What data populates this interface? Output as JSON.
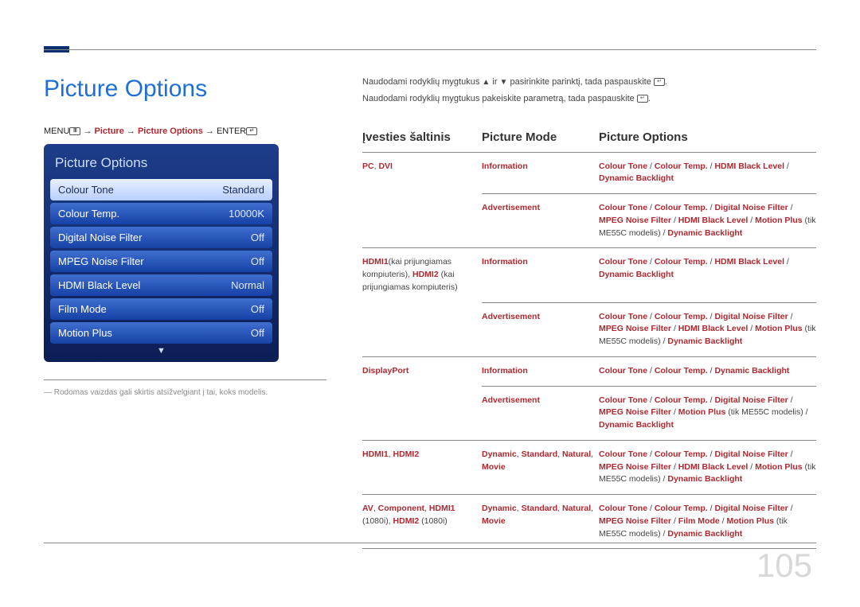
{
  "title": "Picture Options",
  "breadcrumb": {
    "menu": "MENU",
    "arrow": " → ",
    "picture": "Picture",
    "picture_options": "Picture Options",
    "enter": "ENTER"
  },
  "panel": {
    "title": "Picture Options",
    "rows": [
      {
        "label": "Colour Tone",
        "value": "Standard",
        "highlight": true
      },
      {
        "label": "Colour Temp.",
        "value": "10000K"
      },
      {
        "label": "Digital Noise Filter",
        "value": "Off"
      },
      {
        "label": "MPEG Noise Filter",
        "value": "Off"
      },
      {
        "label": "HDMI Black Level",
        "value": "Normal"
      },
      {
        "label": "Film Mode",
        "value": "Off"
      },
      {
        "label": "Motion Plus",
        "value": "Off"
      }
    ]
  },
  "note": "― Rodomas vaizdas gali skirtis atsižvelgiant į tai, koks modelis.",
  "instructions": {
    "line1_a": "Naudodami rodyklių mygtukus ",
    "line1_b": " ir ",
    "line1_c": " pasirinkite parinktį, tada paspauskite ",
    "line1_d": ".",
    "line2_a": "Naudodami rodyklių mygtukus pakeiskite parametrą, tada paspauskite ",
    "line2_b": "."
  },
  "headers": {
    "c1": "Įvesties šaltinis",
    "c2": "Picture Mode",
    "c3": "Picture Options"
  },
  "rows": [
    {
      "source_red": "PC",
      "source_black": ", ",
      "source_red2": "DVI",
      "sub": [
        {
          "mode": [
            [
              "Information",
              "red"
            ]
          ],
          "opts": [
            [
              "Colour Tone",
              "red"
            ],
            [
              " / ",
              "black"
            ],
            [
              "Colour Temp.",
              "red"
            ],
            [
              " / ",
              "black"
            ],
            [
              "HDMI Black Level",
              "red"
            ],
            [
              " / ",
              "black"
            ],
            [
              "Dynamic Backlight",
              "red"
            ]
          ]
        },
        {
          "mode": [
            [
              "Advertisement",
              "red"
            ]
          ],
          "opts": [
            [
              "Colour Tone",
              "red"
            ],
            [
              " / ",
              "black"
            ],
            [
              "Colour Temp.",
              "red"
            ],
            [
              " / ",
              "black"
            ],
            [
              "Digital Noise Filter",
              "red"
            ],
            [
              " / ",
              "black"
            ],
            [
              "MPEG Noise Filter",
              "red"
            ],
            [
              " / ",
              "black"
            ],
            [
              "HDMI Black Level",
              "red"
            ],
            [
              " / ",
              "black"
            ],
            [
              "Motion Plus",
              "red"
            ],
            [
              " (tik ME55C modelis) / ",
              "black"
            ],
            [
              "Dynamic Backlight",
              "red"
            ]
          ]
        }
      ]
    },
    {
      "source_lines": [
        [
          "HDMI1",
          "red"
        ],
        [
          "(kai prijungiamas kompiuteris), ",
          "black"
        ],
        [
          "HDMI2",
          "red"
        ],
        [
          " (kai prijungiamas kompiuteris)",
          "black"
        ]
      ],
      "sub": [
        {
          "mode": [
            [
              "Information",
              "red"
            ]
          ],
          "opts": [
            [
              "Colour Tone",
              "red"
            ],
            [
              " / ",
              "black"
            ],
            [
              "Colour Temp.",
              "red"
            ],
            [
              " / ",
              "black"
            ],
            [
              "HDMI Black Level",
              "red"
            ],
            [
              " / ",
              "black"
            ],
            [
              "Dynamic Backlight",
              "red"
            ]
          ]
        },
        {
          "mode": [
            [
              "Advertisement",
              "red"
            ]
          ],
          "opts": [
            [
              "Colour Tone",
              "red"
            ],
            [
              " / ",
              "black"
            ],
            [
              "Colour Temp.",
              "red"
            ],
            [
              " / ",
              "black"
            ],
            [
              "Digital Noise Filter",
              "red"
            ],
            [
              " / ",
              "black"
            ],
            [
              "MPEG Noise Filter",
              "red"
            ],
            [
              " / ",
              "black"
            ],
            [
              "HDMI Black Level",
              "red"
            ],
            [
              " / ",
              "black"
            ],
            [
              "Motion Plus",
              "red"
            ],
            [
              " (tik ME55C modelis) / ",
              "black"
            ],
            [
              "Dynamic Backlight",
              "red"
            ]
          ]
        }
      ]
    },
    {
      "source_lines": [
        [
          "DisplayPort",
          "red"
        ]
      ],
      "sub": [
        {
          "mode": [
            [
              "Information",
              "red"
            ]
          ],
          "opts": [
            [
              "Colour Tone",
              "red"
            ],
            [
              " / ",
              "black"
            ],
            [
              "Colour Temp.",
              "red"
            ],
            [
              " / ",
              "black"
            ],
            [
              "Dynamic Backlight",
              "red"
            ]
          ]
        },
        {
          "mode": [
            [
              "Advertisement",
              "red"
            ]
          ],
          "opts": [
            [
              "Colour Tone",
              "red"
            ],
            [
              " / ",
              "black"
            ],
            [
              "Colour Temp.",
              "red"
            ],
            [
              " / ",
              "black"
            ],
            [
              "Digital Noise Filter",
              "red"
            ],
            [
              " / ",
              "black"
            ],
            [
              "MPEG Noise Filter",
              "red"
            ],
            [
              " / ",
              "black"
            ],
            [
              "Motion Plus",
              "red"
            ],
            [
              " (tik ME55C modelis) / ",
              "black"
            ],
            [
              "Dynamic Backlight",
              "red"
            ]
          ]
        }
      ]
    },
    {
      "source_lines": [
        [
          "HDMI1",
          "red"
        ],
        [
          ", ",
          "black"
        ],
        [
          "HDMI2",
          "red"
        ]
      ],
      "sub": [
        {
          "mode": [
            [
              "Dynamic",
              "red"
            ],
            [
              ", ",
              "black"
            ],
            [
              "Standard",
              "red"
            ],
            [
              ", ",
              "black"
            ],
            [
              "Natural",
              "red"
            ],
            [
              ", ",
              "black"
            ],
            [
              "Movie",
              "red"
            ]
          ],
          "opts": [
            [
              "Colour Tone",
              "red"
            ],
            [
              " / ",
              "black"
            ],
            [
              "Colour Temp.",
              "red"
            ],
            [
              " / ",
              "black"
            ],
            [
              "Digital Noise Filter",
              "red"
            ],
            [
              " / ",
              "black"
            ],
            [
              "MPEG Noise Filter",
              "red"
            ],
            [
              " / ",
              "black"
            ],
            [
              "HDMI Black Level",
              "red"
            ],
            [
              " / ",
              "black"
            ],
            [
              "Motion Plus",
              "red"
            ],
            [
              " (tik ME55C modelis) / ",
              "black"
            ],
            [
              "Dynamic Backlight",
              "red"
            ]
          ]
        }
      ]
    },
    {
      "source_lines": [
        [
          "AV",
          "red"
        ],
        [
          ", ",
          "black"
        ],
        [
          "Component",
          "red"
        ],
        [
          ", ",
          "black"
        ],
        [
          "HDMI1",
          "red"
        ],
        [
          " (1080i), ",
          "black"
        ],
        [
          "HDMI2",
          "red"
        ],
        [
          " (1080i)",
          "black"
        ]
      ],
      "sub": [
        {
          "mode": [
            [
              "Dynamic",
              "red"
            ],
            [
              ", ",
              "black"
            ],
            [
              "Standard",
              "red"
            ],
            [
              ", ",
              "black"
            ],
            [
              "Natural",
              "red"
            ],
            [
              ", ",
              "black"
            ],
            [
              "Movie",
              "red"
            ]
          ],
          "opts": [
            [
              "Colour Tone",
              "red"
            ],
            [
              " / ",
              "black"
            ],
            [
              "Colour Temp.",
              "red"
            ],
            [
              " / ",
              "black"
            ],
            [
              "Digital Noise Filter",
              "red"
            ],
            [
              " / ",
              "black"
            ],
            [
              "MPEG Noise Filter",
              "red"
            ],
            [
              " / ",
              "black"
            ],
            [
              "Film Mode",
              "red"
            ],
            [
              " / ",
              "black"
            ],
            [
              "Motion Plus",
              "red"
            ],
            [
              " (tik ME55C modelis) / ",
              "black"
            ],
            [
              "Dynamic Backlight",
              "red"
            ]
          ]
        }
      ]
    }
  ],
  "page_num": "105"
}
